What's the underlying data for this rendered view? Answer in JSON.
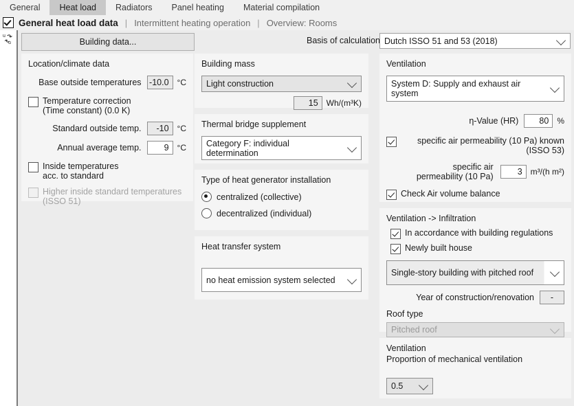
{
  "tabs": [
    {
      "label": "General",
      "active": false
    },
    {
      "label": "Heat load",
      "active": true
    },
    {
      "label": "Radiators",
      "active": false
    },
    {
      "label": "Panel heating",
      "active": false
    },
    {
      "label": "Material compilation",
      "active": false
    }
  ],
  "header": {
    "title": "General heat load data",
    "separator": "|",
    "link1": "Intermittent heating operation",
    "link2": "Overview: Rooms"
  },
  "toolbar": {
    "building_data_button": "Building data...",
    "basis_label": "Basis of calculation",
    "basis_value": "Dutch ISSO 51 and 53 (2018)"
  },
  "location": {
    "title": "Location/climate data",
    "base_outside_label": "Base outside temperatures",
    "base_outside_value": "-10.0",
    "base_outside_unit": "°C",
    "temp_correction_label": "Temperature correction",
    "temp_correction_label2": "(Time constant) (0.0 K)",
    "temp_correction_checked": false,
    "standard_outside_label": "Standard outside temp.",
    "standard_outside_value": "-10",
    "standard_outside_unit": "°C",
    "annual_avg_label": "Annual average temp.",
    "annual_avg_value": "9",
    "annual_avg_unit": "°C",
    "inside_std_label": "Inside temperatures",
    "inside_std_label2": "acc. to standard",
    "inside_std_checked": false,
    "higher_inside_label": "Higher inside standard temperatures",
    "higher_inside_label2": "(ISSO 51)",
    "higher_inside_checked": false
  },
  "building_mass": {
    "title": "Building mass",
    "value": "Light construction",
    "capacity_value": "15",
    "capacity_unit": "Wh/(m³K)"
  },
  "thermal_bridge": {
    "title": "Thermal bridge supplement",
    "value": "Category F: individual determination"
  },
  "heat_generator": {
    "title": "Type of heat generator installation",
    "option1": "centralized (collective)",
    "option2": "decentralized (individual)",
    "selected": "option1"
  },
  "heat_transfer": {
    "title": "Heat transfer system",
    "value": "no heat emission system selected"
  },
  "ventilation": {
    "title": "Ventilation",
    "system_value": "System D: Supply and exhaust air system",
    "eta_label": "η-Value (HR)",
    "eta_value": "80",
    "eta_unit": "%",
    "permeability_known_label": "specific air permeability (10 Pa) known (ISSO 53)",
    "permeability_known_checked": true,
    "permeability_label": "specific air",
    "permeability_label2": "permeability (10 Pa)",
    "permeability_value": "3",
    "permeability_unit": "m³/(h m²)",
    "air_balance_label": "Check Air volume balance",
    "air_balance_checked": true
  },
  "infiltration": {
    "title": "Ventilation -> Infiltration",
    "regulations_label": "In accordance with building regulations",
    "regulations_checked": true,
    "newly_built_label": "Newly built house",
    "newly_built_checked": true,
    "building_type_value": "Single-story building with pitched roof",
    "year_label": "Year of construction/renovation",
    "year_value": "-",
    "roof_type_label": "Roof type",
    "roof_type_value": "Pitched roof"
  },
  "mech_ventilation": {
    "title": "Ventilation",
    "subtitle": "Proportion of mechanical ventilation",
    "value": "0.5"
  },
  "icons": {
    "swap": "swap-units-icon",
    "header_check": "enabled-checkbox-icon"
  },
  "colors": {
    "panel_bg": "#f5f5f5",
    "content_bg": "#ececec",
    "active_tab": "#c8c8c8"
  }
}
